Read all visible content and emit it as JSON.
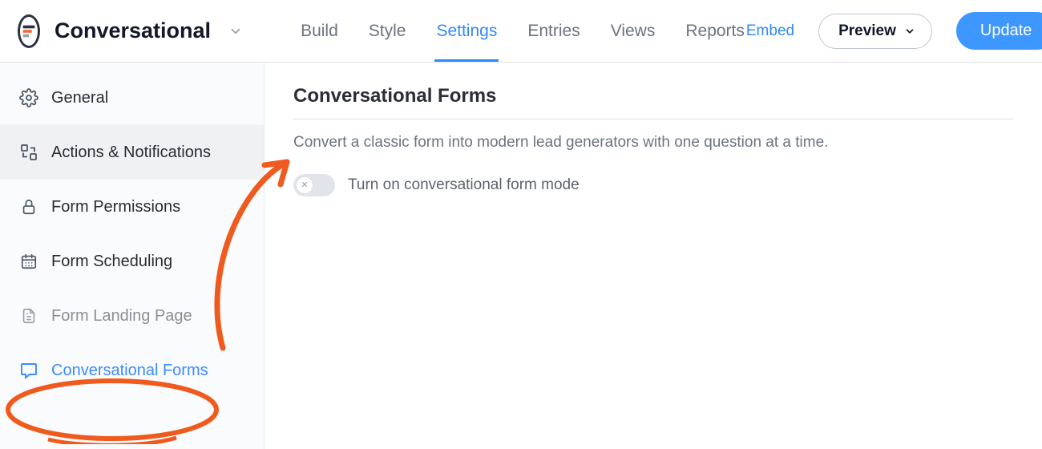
{
  "header": {
    "form_title": "Conversational",
    "tabs": [
      "Build",
      "Style",
      "Settings",
      "Entries",
      "Views",
      "Reports"
    ],
    "active_tab_index": 2,
    "embed": "Embed",
    "preview": "Preview",
    "update": "Update"
  },
  "sidebar": {
    "items": [
      {
        "icon": "gear-icon",
        "label": "General"
      },
      {
        "icon": "swap-icon",
        "label": "Actions & Notifications"
      },
      {
        "icon": "lock-icon",
        "label": "Form Permissions"
      },
      {
        "icon": "calendar-icon",
        "label": "Form Scheduling"
      },
      {
        "icon": "page-icon",
        "label": "Form Landing Page"
      },
      {
        "icon": "chat-icon",
        "label": "Conversational Forms"
      }
    ],
    "highlighted_index": 1,
    "active_index": 5,
    "muted_indices": [
      4
    ]
  },
  "panel": {
    "title": "Conversational Forms",
    "description": "Convert a classic form into modern lead generators with one question at a time.",
    "toggle_label": "Turn on conversational form mode",
    "toggle_on": false
  }
}
